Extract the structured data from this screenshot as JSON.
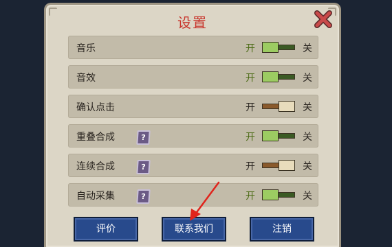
{
  "dialog": {
    "title": "设置",
    "close_icon": "close-x-icon"
  },
  "settings": [
    {
      "label": "音乐",
      "on_label": "开",
      "off_label": "关",
      "enabled": true,
      "has_help": false
    },
    {
      "label": "音效",
      "on_label": "开",
      "off_label": "关",
      "enabled": true,
      "has_help": false
    },
    {
      "label": "确认点击",
      "on_label": "开",
      "off_label": "关",
      "enabled": false,
      "has_help": false
    },
    {
      "label": "重叠合成",
      "on_label": "开",
      "off_label": "关",
      "enabled": true,
      "has_help": true,
      "help_text": "?"
    },
    {
      "label": "连续合成",
      "on_label": "开",
      "off_label": "关",
      "enabled": false,
      "has_help": true,
      "help_text": "?"
    },
    {
      "label": "自动采集",
      "on_label": "开",
      "off_label": "关",
      "enabled": true,
      "has_help": true,
      "help_text": "?"
    }
  ],
  "buttons": {
    "rate": "评价",
    "contact": "联系我们",
    "logout": "注销"
  },
  "colors": {
    "title": "#c8352c",
    "on_label": "#4a6a14",
    "off_label": "#2a2520",
    "button_bg": "#284a8c",
    "annotation_arrow": "#e0241c"
  }
}
